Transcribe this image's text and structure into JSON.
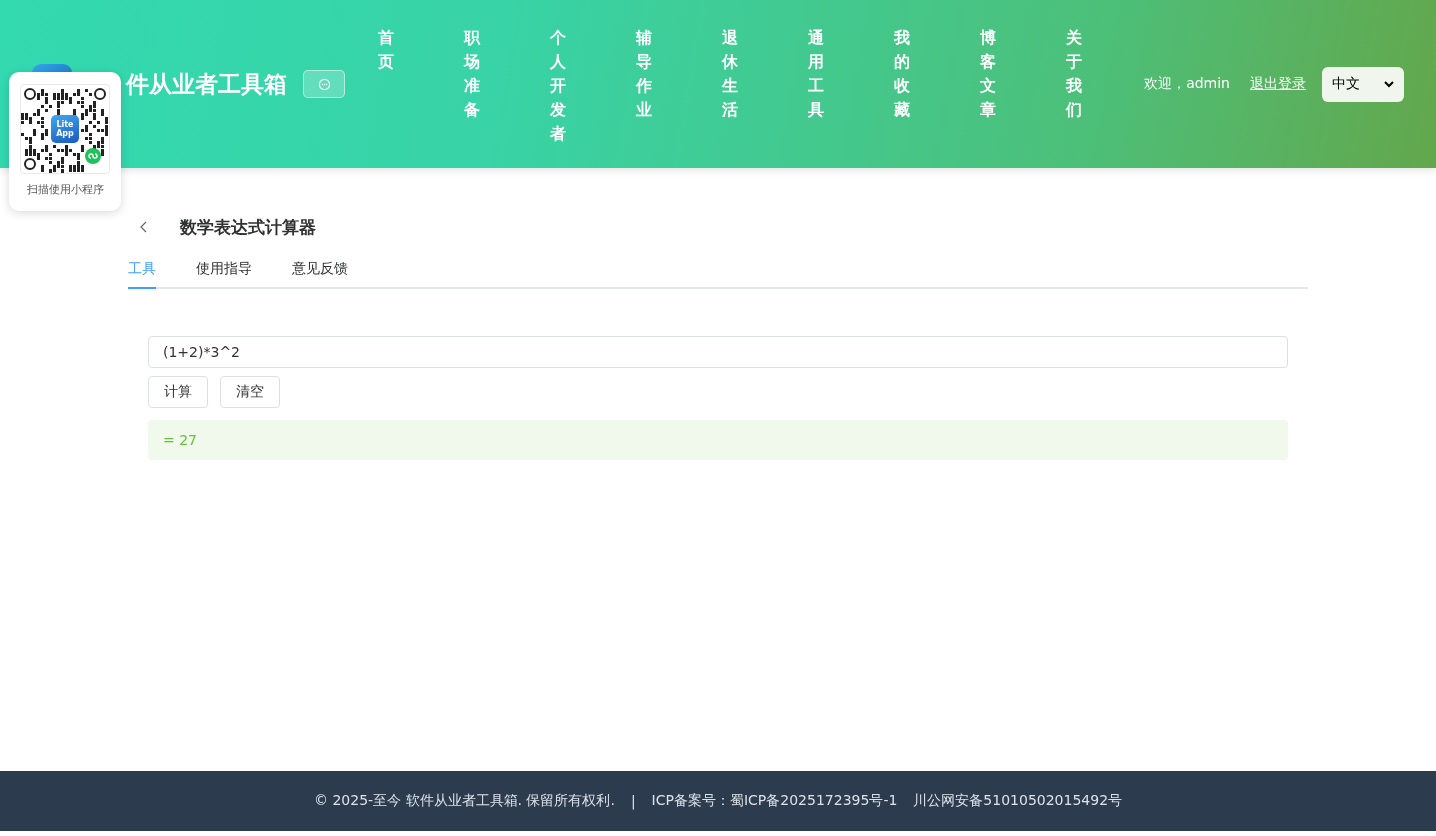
{
  "header": {
    "site_title": "件从业者工具箱",
    "nav": [
      {
        "label": "首页"
      },
      {
        "label": "职场准备"
      },
      {
        "label": "个人开发者"
      },
      {
        "label": "辅导作业"
      },
      {
        "label": "退休生活"
      },
      {
        "label": "通用工具"
      },
      {
        "label": "我的收藏"
      },
      {
        "label": "博客文章"
      },
      {
        "label": "关于我们"
      }
    ],
    "welcome": "欢迎，admin",
    "logout": "退出登录",
    "language": "中文"
  },
  "qr_popup": {
    "logo": "Lite App",
    "caption": "扫描使用小程序"
  },
  "page": {
    "title": "数学表达式计算器",
    "tabs": [
      {
        "label": "工具",
        "selected": true
      },
      {
        "label": "使用指导",
        "selected": false
      },
      {
        "label": "意见反馈",
        "selected": false
      }
    ],
    "expression": "(1+2)*3^2",
    "buttons": [
      "计算",
      "清空"
    ],
    "result": "= 27"
  },
  "footer": {
    "copyright": "© 2025-至今 软件从业者工具箱. 保留所有权利.",
    "separator": "|",
    "icp": "ICP备案号：蜀ICP备2025172395号-1",
    "police": "川公网安备51010502015492号"
  }
}
